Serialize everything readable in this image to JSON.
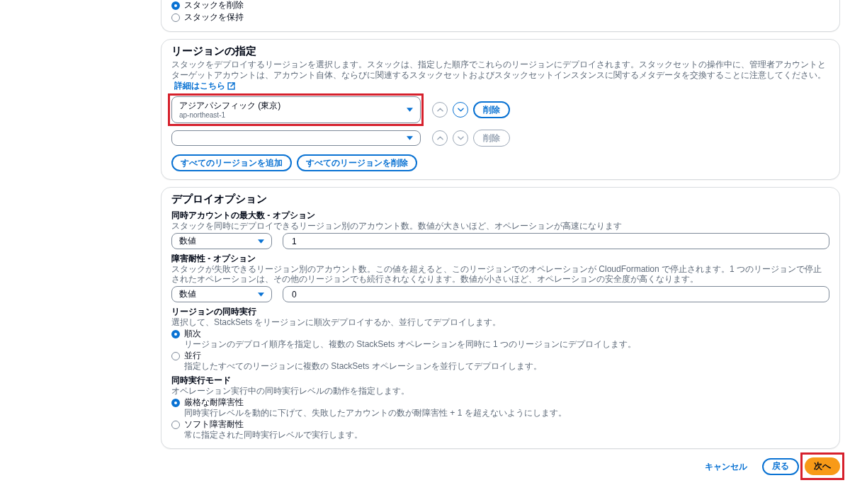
{
  "top_card": {
    "options": [
      {
        "label": "スタックを削除",
        "selected": true
      },
      {
        "label": "スタックを保持",
        "selected": false
      }
    ]
  },
  "region_card": {
    "title": "リージョンの指定",
    "description": "スタックをデプロイするリージョンを選択します。スタックは、指定した順序でこれらのリージョンにデプロイされます。スタックセットの操作中に、管理者アカウントとターゲットアカウントは、アカウント自体、ならびに関連するスタックセットおよびスタックセットインスタンスに関するメタデータを交換することに注意してください。",
    "link": "詳細はこちら",
    "regions": [
      {
        "name": "アジアパシフィック (東京)",
        "code": "ap-northeast-1",
        "highlighted": true,
        "up_disabled": true,
        "down_disabled": false,
        "remove_label": "削除",
        "remove_disabled": false
      },
      {
        "highlighted": false,
        "up_disabled": true,
        "down_disabled": true,
        "remove_label": "削除",
        "remove_disabled": true
      }
    ],
    "buttons": [
      {
        "label": "すべてのリージョンを追加"
      },
      {
        "label": "すべてのリージョンを削除"
      }
    ]
  },
  "deploy_card": {
    "title": "デプロイオプション",
    "fields": [
      {
        "kind": "number",
        "label": "同時アカウントの最大数 - オプション",
        "description": "スタックを同時にデプロイできるリージョン別のアカウント数。数値が大きいほど、オペレーションが高速になります",
        "mode": "数値",
        "value": "1"
      },
      {
        "kind": "number",
        "label": "障害耐性 - オプション",
        "description": "スタックが失敗できるリージョン別のアカウント数。この値を超えると、このリージョンでのオペレーションが CloudFormation で停止されます。1 つのリージョンで停止されたオペレーションは、その他のリージョンでも続行されなくなります。数値が小さいほど、オペレーションの安全度が高くなります。",
        "mode": "数値",
        "value": "0"
      },
      {
        "kind": "radio",
        "label": "リージョンの同時実行",
        "description": "選択して、StackSets をリージョンに順次デプロイするか、並行してデプロイします。",
        "options": [
          {
            "label": "順次",
            "description": "リージョンのデプロイ順序を指定し、複数の StackSets オペレーションを同時に 1 つのリージョンにデプロイします。",
            "selected": true
          },
          {
            "label": "並行",
            "description": "指定したすべてのリージョンに複数の StackSets オペレーションを並行してデプロイします。",
            "selected": false
          }
        ]
      },
      {
        "kind": "radio",
        "label": "同時実行モード",
        "description": "オペレーション実行中の同時実行レベルの動作を指定します。",
        "options": [
          {
            "label": "厳格な耐障害性",
            "description": "同時実行レベルを動的に下げて、失敗したアカウントの数が耐障害性 + 1 を超えないようにします。",
            "selected": true
          },
          {
            "label": "ソフト障害耐性",
            "description": "常に指定された同時実行レベルで実行します。",
            "selected": false
          }
        ]
      }
    ]
  },
  "footer": {
    "buttons": [
      {
        "kind": "link",
        "label": "キャンセル",
        "highlighted": false
      },
      {
        "kind": "normal",
        "label": "戻る",
        "highlighted": false
      },
      {
        "kind": "primary",
        "label": "次へ",
        "highlighted": true
      }
    ]
  }
}
